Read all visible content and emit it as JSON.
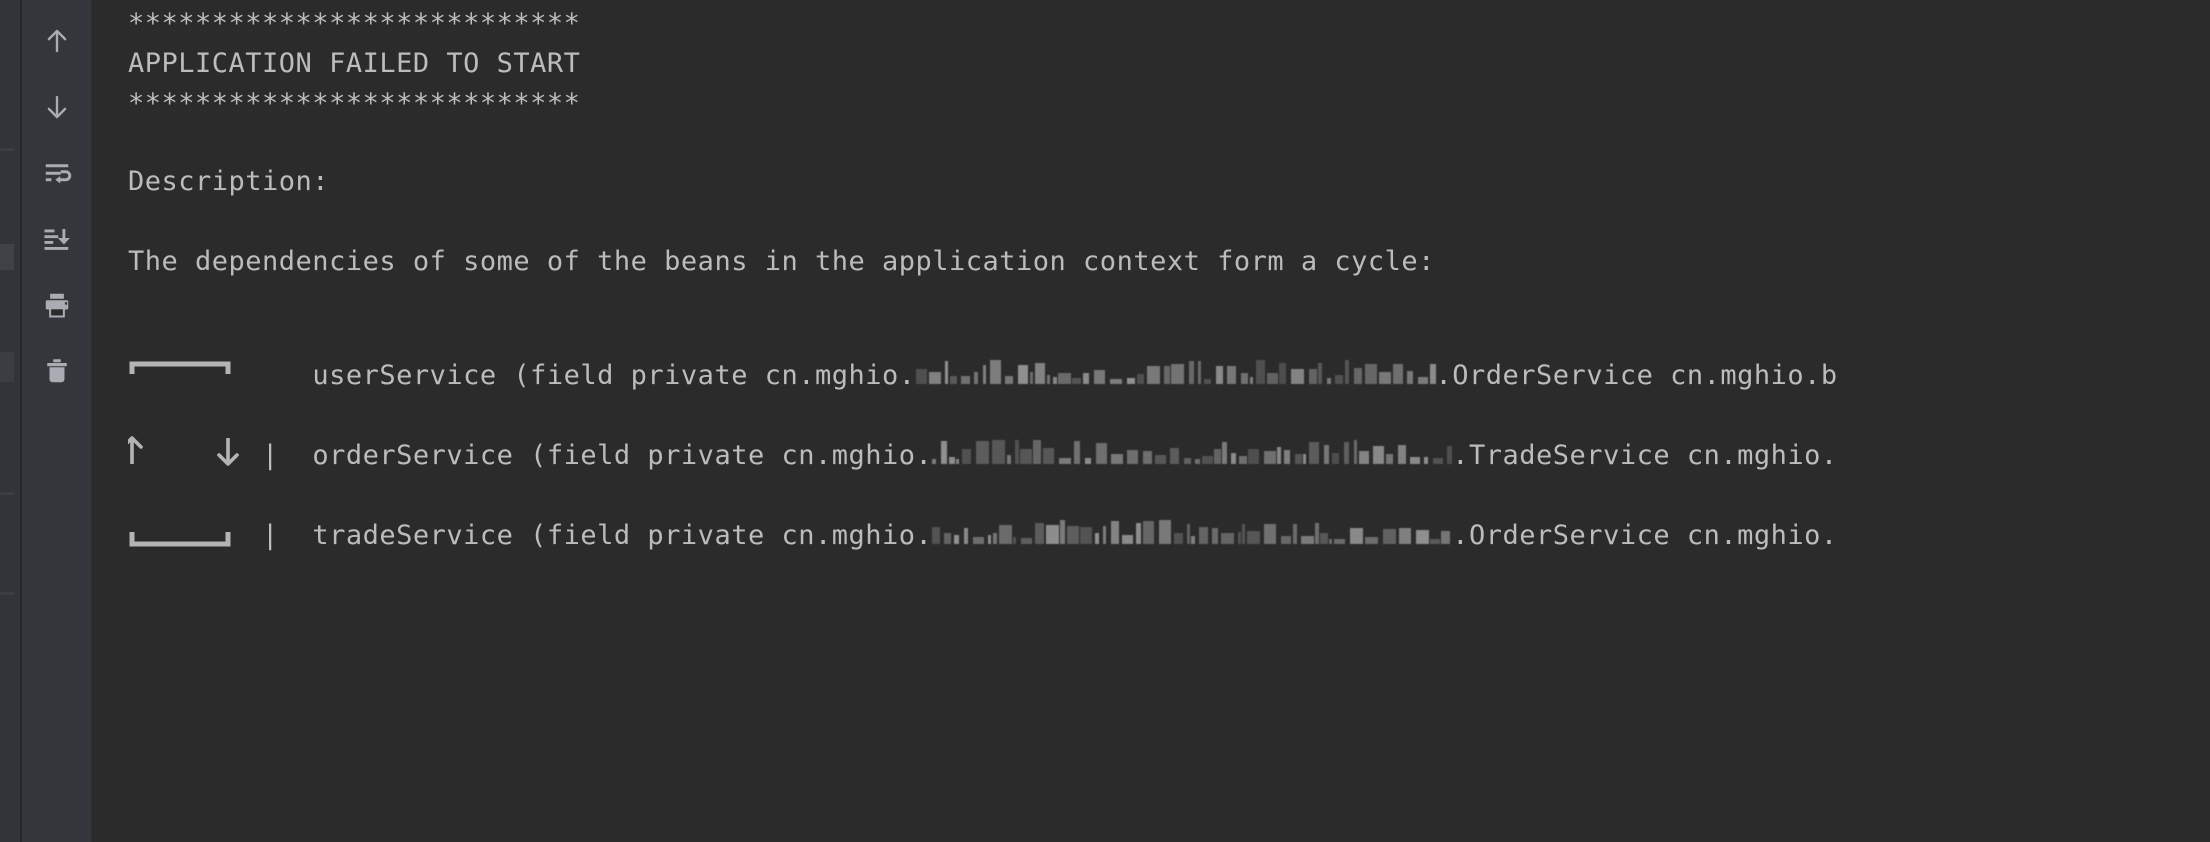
{
  "colors": {
    "console_background": "#2b2b2b",
    "toolbar_background": "#33363b",
    "window_edge": "#313438",
    "text": "#bcbcbc",
    "icon": "#a9adb3"
  },
  "toolbar": {
    "name": "console-toolbar",
    "buttons": [
      {
        "name": "up-arrow-icon",
        "label": "Previous Occurrence"
      },
      {
        "name": "down-arrow-icon",
        "label": "Next Occurrence"
      },
      {
        "name": "soft-wrap-icon",
        "label": "Soft-Wrap"
      },
      {
        "name": "scroll-to-end-icon",
        "label": "Scroll to End"
      },
      {
        "name": "print-icon",
        "label": "Print"
      },
      {
        "name": "trash-icon",
        "label": "Clear All"
      }
    ]
  },
  "console": {
    "name": "run-console-output",
    "banner_top": "***************************",
    "banner_title": "APPLICATION FAILED TO START",
    "banner_bottom": "***************************",
    "description_label": "Description:",
    "description_text": "The dependencies of some of the beans in the application context form a cycle:",
    "cycle": {
      "lines": [
        {
          "name": "cycle-line-user-service",
          "prefix": "   userService (field private cn.mghio.",
          "redacted": true,
          "suffix": ".OrderService cn.mghio.b"
        },
        {
          "name": "cycle-line-order-service",
          "prefix": "|  orderService (field private cn.mghio.",
          "redacted": true,
          "suffix": ".TradeService cn.mghio."
        },
        {
          "name": "cycle-line-trade-service",
          "prefix": "|  tradeService (field private cn.mghio.",
          "redacted": true,
          "suffix": ".OrderService cn.mghio."
        }
      ],
      "box_top": "┌─────┐",
      "box_bottom": "└─────┘",
      "arrow_up": "↑",
      "arrow_down": "↓",
      "pipe": "|"
    }
  }
}
